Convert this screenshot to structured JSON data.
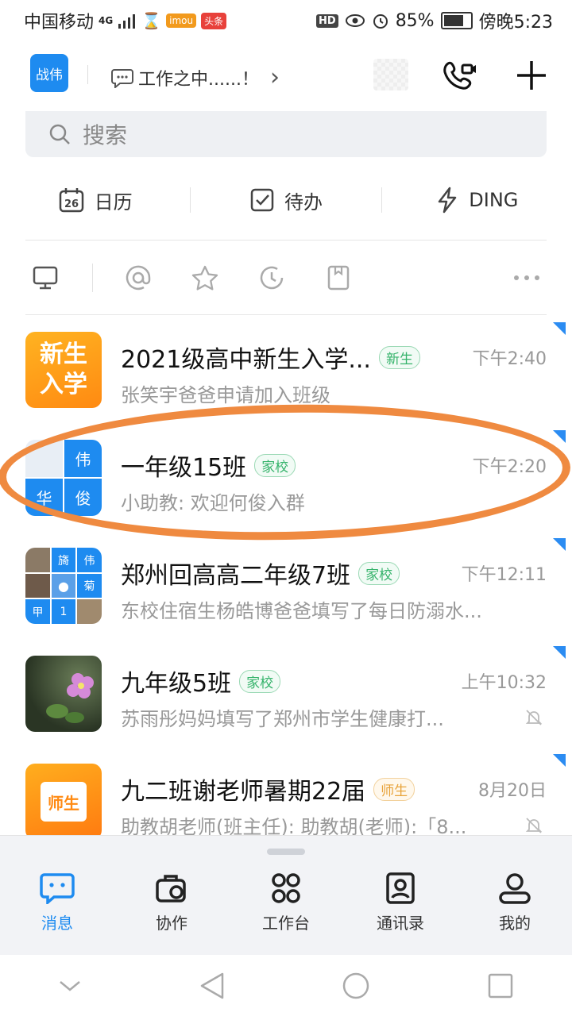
{
  "status_bar": {
    "carrier": "中国移动",
    "network": "4G",
    "app_badge_1": "imou",
    "app_badge_2": "头条",
    "hd": "HD",
    "battery": "85%",
    "battery_level": 0.85,
    "time": "傍晚5:23"
  },
  "header": {
    "avatar_text": "战伟",
    "status_text": "工作之中......！",
    "chevron": "›"
  },
  "search": {
    "placeholder": "搜索"
  },
  "quick_actions": [
    {
      "label": "日历",
      "icon": "calendar-icon",
      "day": "26"
    },
    {
      "label": "待办",
      "icon": "checkbox-icon"
    },
    {
      "label": "DING",
      "icon": "lightning-icon"
    }
  ],
  "filters": [
    "monitor-icon",
    "at-icon",
    "star-icon",
    "clock-icon",
    "bookmark-icon",
    "more-icon"
  ],
  "conversations": [
    {
      "title": "2021级高中新生入学...",
      "tag": "新生",
      "tag_style": "green",
      "time": "下午2:40",
      "preview": "张笑宇爸爸申请加入班级",
      "avatar_text": "新生\n入学",
      "muted": false
    },
    {
      "title": "一年级15班",
      "tag": "家校",
      "tag_style": "green",
      "time": "下午2:20",
      "preview": "小助教: 欢迎何俊入群",
      "avatar_cells": [
        "伟",
        "华",
        "俊"
      ],
      "muted": false
    },
    {
      "title": "郑州回高高二年级7班",
      "tag": "家校",
      "tag_style": "green",
      "time": "下午12:11",
      "preview": "东校住宿生杨皓博爸爸填写了每日防溺水...",
      "avatar_cells": [
        "旖",
        "伟",
        "菊",
        "甲",
        "1"
      ],
      "muted": false
    },
    {
      "title": "九年级5班",
      "tag": "家校",
      "tag_style": "green",
      "time": "上午10:32",
      "preview": "苏雨彤妈妈填写了郑州市学生健康打...",
      "muted": true
    },
    {
      "title": "九二班谢老师暑期22届",
      "tag": "师生",
      "tag_style": "orange",
      "time": "8月20日",
      "preview": "助教胡老师(班主任): 助教胡(老师):「8...",
      "avatar_text": "师生",
      "muted": true
    }
  ],
  "bottom_nav": [
    {
      "label": "消息",
      "icon": "message-icon",
      "active": true
    },
    {
      "label": "协作",
      "icon": "collab-icon",
      "active": false
    },
    {
      "label": "工作台",
      "icon": "workbench-icon",
      "active": false
    },
    {
      "label": "通讯录",
      "icon": "contacts-icon",
      "active": false
    },
    {
      "label": "我的",
      "icon": "profile-icon",
      "active": false
    }
  ],
  "colors": {
    "accent": "#1e8bf0",
    "annotation": "#ef8a40",
    "tag_green": "#35b36b",
    "tag_orange": "#e8a33a"
  }
}
